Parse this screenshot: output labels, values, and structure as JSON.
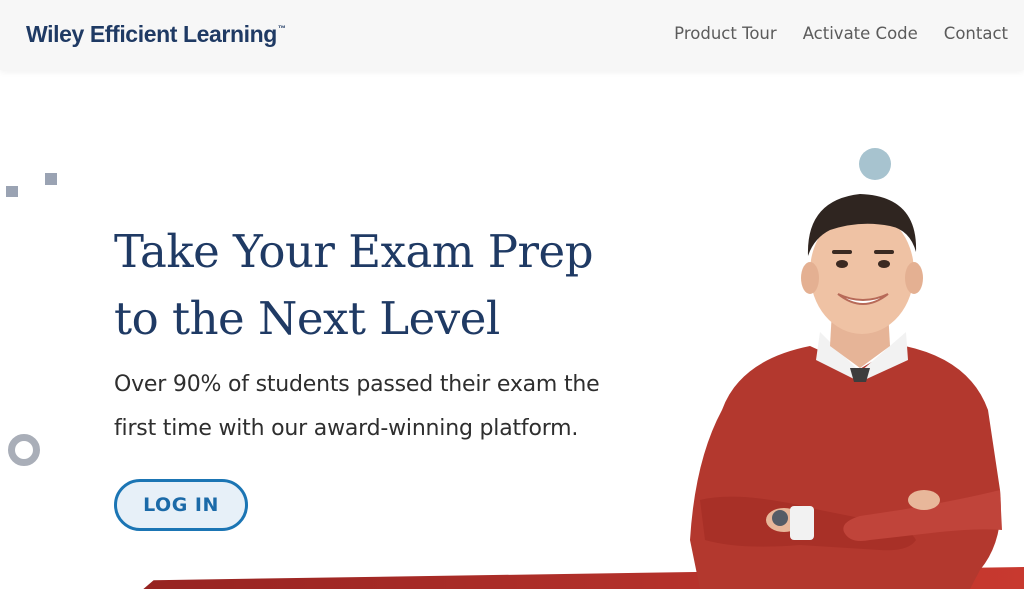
{
  "header": {
    "logo_text": "Wiley Efficient Learning",
    "logo_tm": "™",
    "nav": [
      "Product Tour",
      "Activate Code",
      "Contact"
    ]
  },
  "hero": {
    "title_line1": "Take Your Exam Prep",
    "title_line2": "to the Next Level",
    "subtitle_line1": "Over 90% of students passed their exam the",
    "subtitle_line2": "first time with our award-winning platform.",
    "login_label": "LOG IN"
  },
  "colors": {
    "brand_navy": "#1f3a64",
    "button_blue": "#1b75b4",
    "sweater_red": "#b3382e",
    "band_red": "#b1302a"
  }
}
